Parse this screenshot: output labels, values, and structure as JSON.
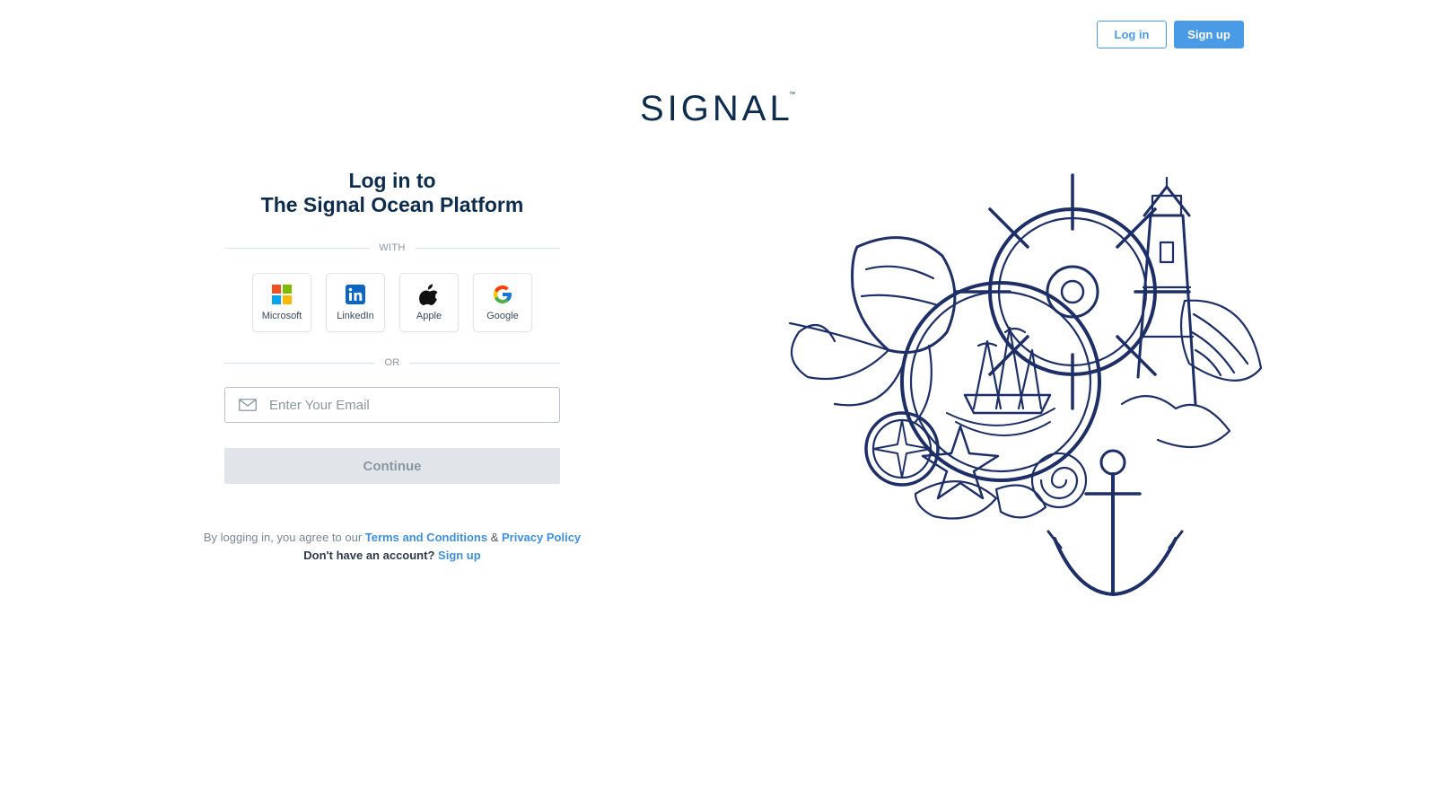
{
  "header": {
    "login_label": "Log in",
    "signup_label": "Sign up"
  },
  "logo": {
    "text": "SIGNAL",
    "trademark": "™"
  },
  "login": {
    "title_line1": "Log in to",
    "title_line2": "The Signal Ocean Platform",
    "with_divider": "WITH",
    "or_divider": "OR",
    "providers": [
      {
        "label": "Microsoft",
        "icon": "microsoft-icon"
      },
      {
        "label": "LinkedIn",
        "icon": "linkedin-icon"
      },
      {
        "label": "Apple",
        "icon": "apple-icon"
      },
      {
        "label": "Google",
        "icon": "google-icon"
      }
    ],
    "email_placeholder": "Enter Your Email",
    "email_value": "",
    "continue_label": "Continue"
  },
  "legal": {
    "prefix": "By logging in, you agree to our",
    "terms_label": "Terms and Conditions",
    "ampersand": "&",
    "privacy_label": "Privacy Policy",
    "no_account": "Don't have an account?",
    "signup_link": "Sign up"
  },
  "colors": {
    "brand_navy": "#0e2c4e",
    "accent_blue": "#4a9be6",
    "button_disabled": "#e1e5ea"
  }
}
